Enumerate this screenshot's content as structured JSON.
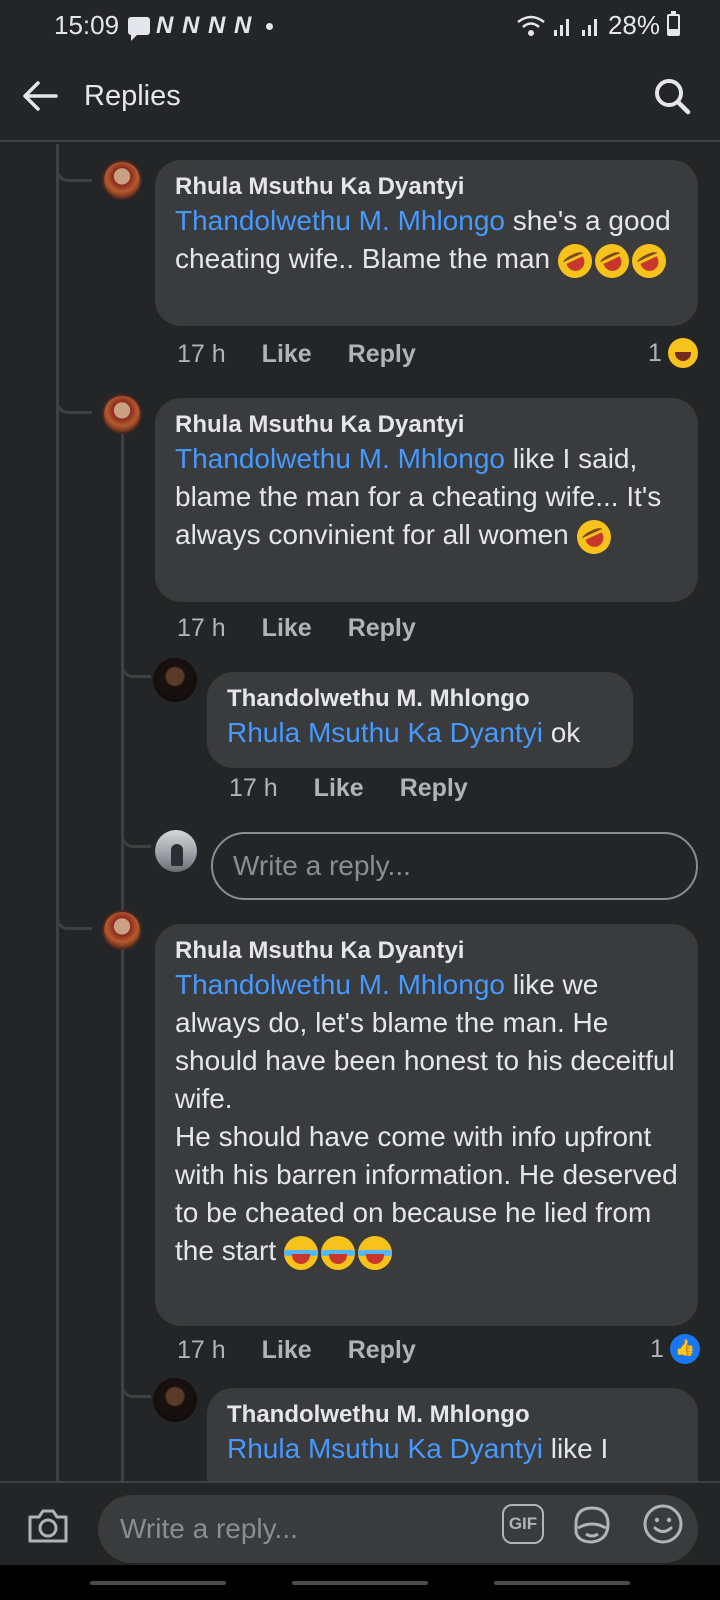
{
  "status_bar": {
    "time": "15:09",
    "notification_letters": "N N N N",
    "battery": "28%"
  },
  "header": {
    "title": "Replies"
  },
  "comments": [
    {
      "author": "Rhula Msuthu Ka Dyantyi",
      "mention": "Thandolwethu M. Mhlongo",
      "text": " she's a good cheating wife.. Blame the man ",
      "emojis": [
        "rofl",
        "rofl",
        "rofl"
      ],
      "time": "17 h",
      "like": "Like",
      "reply": "Reply",
      "reaction_count": "1",
      "reaction": "laugh"
    },
    {
      "author": "Rhula Msuthu Ka Dyantyi",
      "mention": "Thandolwethu M. Mhlongo",
      "text": " like I said, blame the man for a cheating wife... It's always convinient for all women ",
      "emojis": [
        "rofl"
      ],
      "time": "17 h",
      "like": "Like",
      "reply": "Reply"
    },
    {
      "author": "Thandolwethu M. Mhlongo",
      "mention": "Rhula Msuthu Ka Dyantyi",
      "text": " ok",
      "time": "17 h",
      "like": "Like",
      "reply": "Reply"
    },
    {
      "author": "Rhula Msuthu Ka Dyantyi",
      "mention": "Thandolwethu M. Mhlongo",
      "text": " like we always do, let's blame the man. He should have been honest to his deceitful wife.",
      "text2": "He should have come with info upfront with his barren information. He deserved to be cheated on because he lied from the start ",
      "emojis": [
        "joy",
        "joy",
        "joy"
      ],
      "time": "17 h",
      "like": "Like",
      "reply": "Reply",
      "reaction_count": "1",
      "reaction": "like"
    },
    {
      "author": "Thandolwethu M. Mhlongo",
      "mention": "Rhula Msuthu Ka Dyantyi",
      "text": " like I"
    }
  ],
  "inline_reply": {
    "placeholder": "Write a reply..."
  },
  "composer": {
    "placeholder": "Write a reply...",
    "gif_label": "GIF"
  },
  "colors": {
    "background": "#242526",
    "bubble": "#3a3b3c",
    "mention": "#4599ff",
    "meta": "#b0b3b8"
  }
}
